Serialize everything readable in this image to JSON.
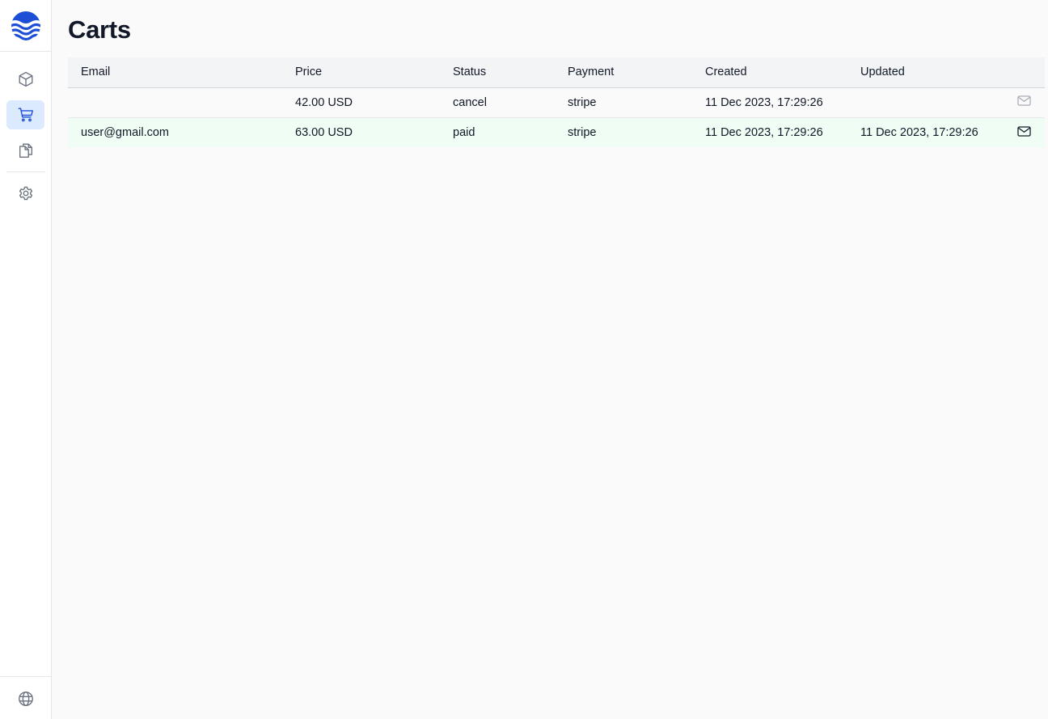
{
  "app": {
    "logo_icon": "waves-logo-icon",
    "brand_color": "#1d4ed8"
  },
  "sidebar": {
    "items": [
      {
        "name": "products",
        "icon": "cube-icon",
        "active": false
      },
      {
        "name": "carts",
        "icon": "cart-icon",
        "active": true
      },
      {
        "name": "pages",
        "icon": "documents-icon",
        "active": false
      },
      {
        "name": "settings",
        "icon": "gear-icon",
        "active": false
      }
    ],
    "footer_icon": "globe-icon"
  },
  "page": {
    "title": "Carts"
  },
  "table": {
    "columns": [
      "Email",
      "Price",
      "Status",
      "Payment",
      "Created",
      "Updated"
    ],
    "rows": [
      {
        "email": "",
        "price": "42.00 USD",
        "status": "cancel",
        "payment": "stripe",
        "created": "11 Dec 2023, 17:29:26",
        "updated": "",
        "action_icon": "mail-icon",
        "action_enabled": false,
        "highlight": false
      },
      {
        "email": "user@gmail.com",
        "price": "63.00 USD",
        "status": "paid",
        "payment": "stripe",
        "created": "11 Dec 2023, 17:29:26",
        "updated": "11 Dec 2023, 17:29:26",
        "action_icon": "mail-icon",
        "action_enabled": true,
        "highlight": true
      }
    ]
  },
  "colors": {
    "active_nav_bg": "#dbeafe",
    "paid_row_bg": "#f0fdf4",
    "header_bg": "#f3f4f6"
  }
}
